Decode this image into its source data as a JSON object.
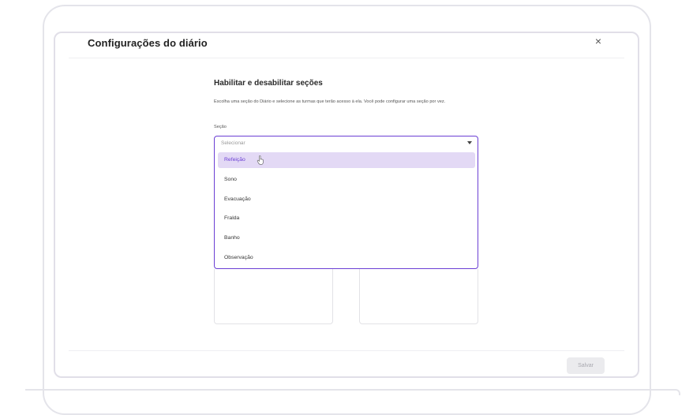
{
  "modal": {
    "title": "Configurações do diário",
    "close_icon": "close-icon"
  },
  "section": {
    "title": "Habilitar e desabilitar seções",
    "description": "Escolha uma seção do Diário e selecione as turmas que terão acesso à ela. Você pode configurar uma seção por vez.",
    "field_label": "Seção"
  },
  "select": {
    "placeholder": "Selecionar",
    "caret_icon": "caret-down-icon",
    "options": [
      {
        "label": "Refeição",
        "highlighted": true
      },
      {
        "label": "Sono"
      },
      {
        "label": "Evacuação"
      },
      {
        "label": "Fralda"
      },
      {
        "label": "Banho"
      },
      {
        "label": "Observação"
      }
    ]
  },
  "footer": {
    "save_label": "Salvar"
  },
  "colors": {
    "accent": "#6b3fd4",
    "highlight": "#e3d9f5"
  }
}
